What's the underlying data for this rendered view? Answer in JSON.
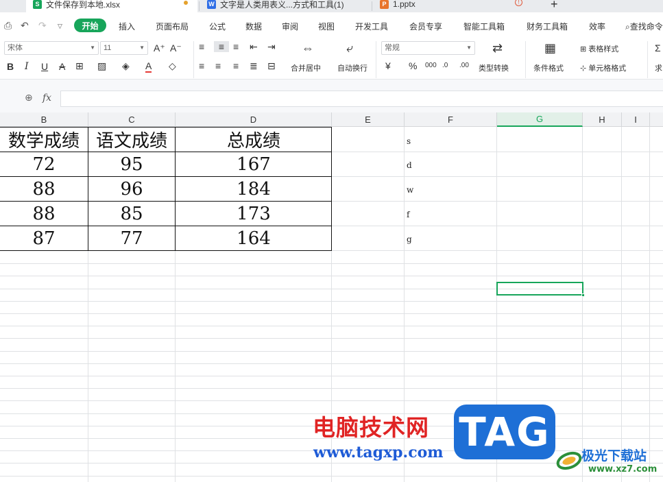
{
  "tabs": [
    {
      "label": "文件保存到本地.xlsx",
      "icon": "S",
      "color": "#17a55a"
    },
    {
      "label": "文字是人类用表义...方式和工具(1)",
      "icon": "W",
      "color": "#2f6ee6"
    },
    {
      "label": "1.pptx",
      "icon": "P",
      "color": "#e8742c"
    }
  ],
  "new_tab": "+",
  "menu": {
    "start": "开始",
    "items": [
      "插入",
      "页面布局",
      "公式",
      "数据",
      "审阅",
      "视图",
      "开发工具",
      "会员专享",
      "智能工具箱",
      "财务工具箱",
      "效率"
    ],
    "search": "查找命令"
  },
  "ribbon": {
    "font_name": "宋体",
    "font_size": "11",
    "merge_label": "合并居中",
    "wrap_label": "自动换行",
    "number_format": "常规",
    "type_convert": "类型转换",
    "cond_format": "条件格式",
    "table_style": "表格样式",
    "cell_style": "单元格格式",
    "sum_label": "求"
  },
  "formula_bar": {
    "fx": "fx",
    "value": ""
  },
  "columns": [
    "B",
    "C",
    "D",
    "E",
    "F",
    "G",
    "H",
    "I"
  ],
  "selected_column": "G",
  "table": {
    "headers": [
      "数学成绩",
      "语文成绩",
      "总成绩"
    ],
    "rows": [
      [
        "72",
        "95",
        "167"
      ],
      [
        "88",
        "96",
        "184"
      ],
      [
        "88",
        "85",
        "173"
      ],
      [
        "87",
        "77",
        "164"
      ]
    ]
  },
  "column_f": [
    "s",
    "d",
    "w",
    "f",
    "g"
  ],
  "watermark": {
    "cn": "电脑技术网",
    "url": "www.tagxp.com",
    "tag": "TAG",
    "site_cn": "极光下载站",
    "site_url": "www.xz7.com"
  }
}
